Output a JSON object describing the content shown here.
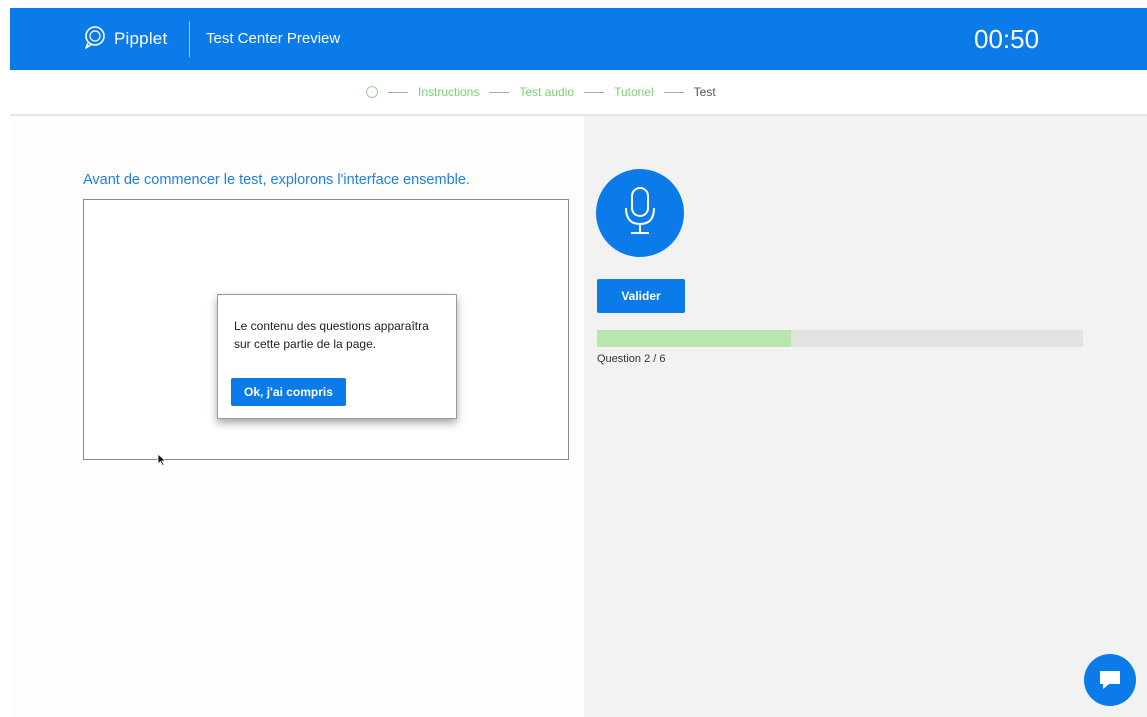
{
  "header": {
    "brand": "Pipplet",
    "page_name": "Test Center Preview",
    "timer": "00:50",
    "color": "#0b7bea"
  },
  "steps": {
    "items": [
      {
        "label": "Instructions",
        "state": "done"
      },
      {
        "label": "Test audio",
        "state": "done"
      },
      {
        "label": "Tutoriel",
        "state": "done"
      },
      {
        "label": "Test",
        "state": "current"
      }
    ],
    "done_color": "#7fcd78"
  },
  "main": {
    "intro": "Avant de commencer le test, explorons l'interface ensemble.",
    "tooltip": {
      "text": "Le contenu des questions apparaîtra sur cette partie de la page.",
      "button_label": "Ok, j'ai compris"
    }
  },
  "side": {
    "mic_icon": "microphone-icon",
    "validate_label": "Valider",
    "progress": {
      "fraction": 0.4,
      "label": "Question 2 / 6"
    }
  },
  "chat": {
    "icon": "chat-bubble-icon"
  }
}
